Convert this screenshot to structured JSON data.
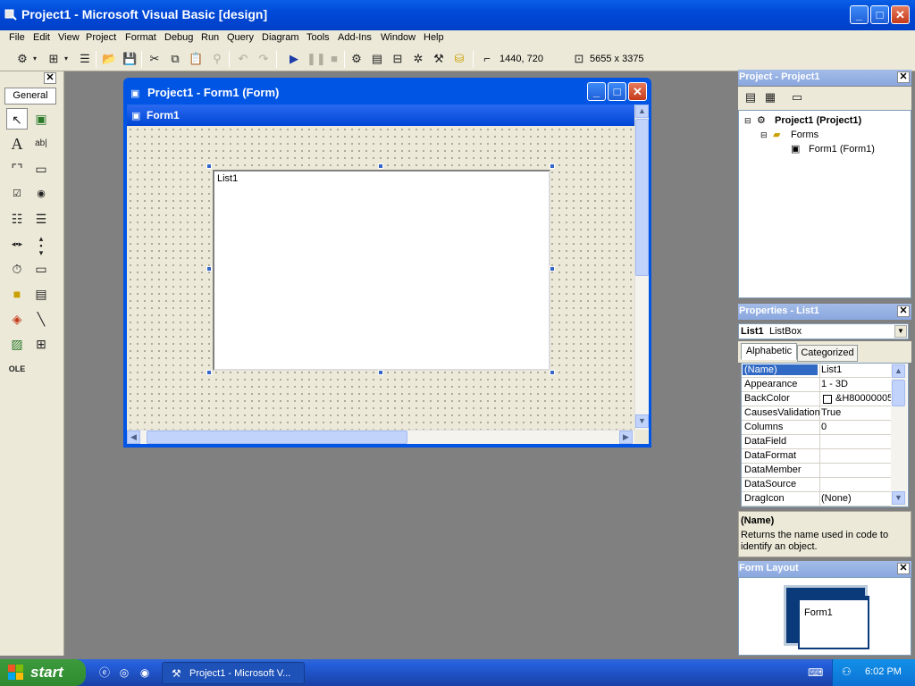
{
  "app": {
    "title": "Project1 - Microsoft Visual Basic [design]"
  },
  "menu": [
    "File",
    "Edit",
    "View",
    "Project",
    "Format",
    "Debug",
    "Run",
    "Query",
    "Diagram",
    "Tools",
    "Add-Ins",
    "Window",
    "Help"
  ],
  "toolbar": {
    "position": "1440, 720",
    "size": "5655 x 3375",
    "icons": [
      "add-project-icon",
      "add-form-icon",
      "menu-editor-icon",
      "open-icon",
      "save-icon",
      "cut-icon",
      "copy-icon",
      "paste-icon",
      "find-icon",
      "undo-icon",
      "redo-icon",
      "start-icon",
      "break-icon",
      "end-icon",
      "project-explorer-icon",
      "properties-window-icon",
      "form-layout-icon",
      "object-browser-icon",
      "toolbox-icon",
      "data-view-icon"
    ]
  },
  "toolbox": {
    "tab": "General",
    "tools": [
      "pointer-icon",
      "picturebox-icon",
      "label-icon",
      "textbox-icon",
      "frame-icon",
      "commandbutton-icon",
      "checkbox-icon",
      "optionbutton-icon",
      "combobox-icon",
      "listbox-icon",
      "hscrollbar-icon",
      "vscrollbar-icon",
      "timer-icon",
      "drivelistbox-icon",
      "dirlistbox-icon",
      "filelistbox-icon",
      "shape-icon",
      "line-icon",
      "image-icon",
      "data-icon",
      "ole-icon"
    ]
  },
  "form_window": {
    "title": "Project1 - Form1 (Form)",
    "caption": "Form1",
    "listbox_text": "List1"
  },
  "project_panel": {
    "title": "Project - Project1",
    "tree": {
      "project": "Project1 (Project1)",
      "folder": "Forms",
      "form": "Form1 (Form1)"
    }
  },
  "properties_panel": {
    "title": "Properties - List1",
    "object_name": "List1",
    "object_type": "ListBox",
    "tabs": [
      "Alphabetic",
      "Categorized"
    ],
    "rows": [
      {
        "name": "(Name)",
        "value": "List1"
      },
      {
        "name": "Appearance",
        "value": "1 - 3D"
      },
      {
        "name": "BackColor",
        "value": "&H80000005&"
      },
      {
        "name": "CausesValidation",
        "value": "True"
      },
      {
        "name": "Columns",
        "value": "0"
      },
      {
        "name": "DataField",
        "value": ""
      },
      {
        "name": "DataFormat",
        "value": ""
      },
      {
        "name": "DataMember",
        "value": ""
      },
      {
        "name": "DataSource",
        "value": ""
      },
      {
        "name": "DragIcon",
        "value": "(None)"
      }
    ],
    "desc_title": "(Name)",
    "desc_text": "Returns the name used in code to identify an object."
  },
  "layout_panel": {
    "title": "Form Layout",
    "form_label": "Form1"
  },
  "taskbar": {
    "start": "start",
    "item": "Project1 - Microsoft V...",
    "clock": "6:02 PM"
  },
  "colors": {
    "titlebar": "#0054e3",
    "panel_bar": "#8aa7df",
    "selection": "#316ac5",
    "start_green": "#3c9b3c"
  }
}
